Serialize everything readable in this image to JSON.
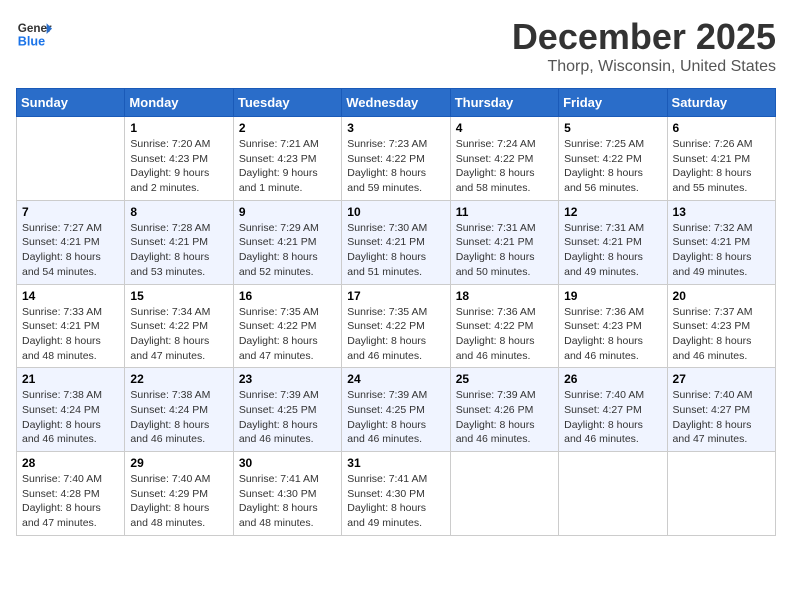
{
  "logo": {
    "line1": "General",
    "line2": "Blue"
  },
  "title": "December 2025",
  "location": "Thorp, Wisconsin, United States",
  "days_of_week": [
    "Sunday",
    "Monday",
    "Tuesday",
    "Wednesday",
    "Thursday",
    "Friday",
    "Saturday"
  ],
  "weeks": [
    [
      {
        "day": "",
        "info": ""
      },
      {
        "day": "1",
        "info": "Sunrise: 7:20 AM\nSunset: 4:23 PM\nDaylight: 9 hours\nand 2 minutes."
      },
      {
        "day": "2",
        "info": "Sunrise: 7:21 AM\nSunset: 4:23 PM\nDaylight: 9 hours\nand 1 minute."
      },
      {
        "day": "3",
        "info": "Sunrise: 7:23 AM\nSunset: 4:22 PM\nDaylight: 8 hours\nand 59 minutes."
      },
      {
        "day": "4",
        "info": "Sunrise: 7:24 AM\nSunset: 4:22 PM\nDaylight: 8 hours\nand 58 minutes."
      },
      {
        "day": "5",
        "info": "Sunrise: 7:25 AM\nSunset: 4:22 PM\nDaylight: 8 hours\nand 56 minutes."
      },
      {
        "day": "6",
        "info": "Sunrise: 7:26 AM\nSunset: 4:21 PM\nDaylight: 8 hours\nand 55 minutes."
      }
    ],
    [
      {
        "day": "7",
        "info": "Sunrise: 7:27 AM\nSunset: 4:21 PM\nDaylight: 8 hours\nand 54 minutes."
      },
      {
        "day": "8",
        "info": "Sunrise: 7:28 AM\nSunset: 4:21 PM\nDaylight: 8 hours\nand 53 minutes."
      },
      {
        "day": "9",
        "info": "Sunrise: 7:29 AM\nSunset: 4:21 PM\nDaylight: 8 hours\nand 52 minutes."
      },
      {
        "day": "10",
        "info": "Sunrise: 7:30 AM\nSunset: 4:21 PM\nDaylight: 8 hours\nand 51 minutes."
      },
      {
        "day": "11",
        "info": "Sunrise: 7:31 AM\nSunset: 4:21 PM\nDaylight: 8 hours\nand 50 minutes."
      },
      {
        "day": "12",
        "info": "Sunrise: 7:31 AM\nSunset: 4:21 PM\nDaylight: 8 hours\nand 49 minutes."
      },
      {
        "day": "13",
        "info": "Sunrise: 7:32 AM\nSunset: 4:21 PM\nDaylight: 8 hours\nand 49 minutes."
      }
    ],
    [
      {
        "day": "14",
        "info": "Sunrise: 7:33 AM\nSunset: 4:21 PM\nDaylight: 8 hours\nand 48 minutes."
      },
      {
        "day": "15",
        "info": "Sunrise: 7:34 AM\nSunset: 4:22 PM\nDaylight: 8 hours\nand 47 minutes."
      },
      {
        "day": "16",
        "info": "Sunrise: 7:35 AM\nSunset: 4:22 PM\nDaylight: 8 hours\nand 47 minutes."
      },
      {
        "day": "17",
        "info": "Sunrise: 7:35 AM\nSunset: 4:22 PM\nDaylight: 8 hours\nand 46 minutes."
      },
      {
        "day": "18",
        "info": "Sunrise: 7:36 AM\nSunset: 4:22 PM\nDaylight: 8 hours\nand 46 minutes."
      },
      {
        "day": "19",
        "info": "Sunrise: 7:36 AM\nSunset: 4:23 PM\nDaylight: 8 hours\nand 46 minutes."
      },
      {
        "day": "20",
        "info": "Sunrise: 7:37 AM\nSunset: 4:23 PM\nDaylight: 8 hours\nand 46 minutes."
      }
    ],
    [
      {
        "day": "21",
        "info": "Sunrise: 7:38 AM\nSunset: 4:24 PM\nDaylight: 8 hours\nand 46 minutes."
      },
      {
        "day": "22",
        "info": "Sunrise: 7:38 AM\nSunset: 4:24 PM\nDaylight: 8 hours\nand 46 minutes."
      },
      {
        "day": "23",
        "info": "Sunrise: 7:39 AM\nSunset: 4:25 PM\nDaylight: 8 hours\nand 46 minutes."
      },
      {
        "day": "24",
        "info": "Sunrise: 7:39 AM\nSunset: 4:25 PM\nDaylight: 8 hours\nand 46 minutes."
      },
      {
        "day": "25",
        "info": "Sunrise: 7:39 AM\nSunset: 4:26 PM\nDaylight: 8 hours\nand 46 minutes."
      },
      {
        "day": "26",
        "info": "Sunrise: 7:40 AM\nSunset: 4:27 PM\nDaylight: 8 hours\nand 46 minutes."
      },
      {
        "day": "27",
        "info": "Sunrise: 7:40 AM\nSunset: 4:27 PM\nDaylight: 8 hours\nand 47 minutes."
      }
    ],
    [
      {
        "day": "28",
        "info": "Sunrise: 7:40 AM\nSunset: 4:28 PM\nDaylight: 8 hours\nand 47 minutes."
      },
      {
        "day": "29",
        "info": "Sunrise: 7:40 AM\nSunset: 4:29 PM\nDaylight: 8 hours\nand 48 minutes."
      },
      {
        "day": "30",
        "info": "Sunrise: 7:41 AM\nSunset: 4:30 PM\nDaylight: 8 hours\nand 48 minutes."
      },
      {
        "day": "31",
        "info": "Sunrise: 7:41 AM\nSunset: 4:30 PM\nDaylight: 8 hours\nand 49 minutes."
      },
      {
        "day": "",
        "info": ""
      },
      {
        "day": "",
        "info": ""
      },
      {
        "day": "",
        "info": ""
      }
    ]
  ]
}
